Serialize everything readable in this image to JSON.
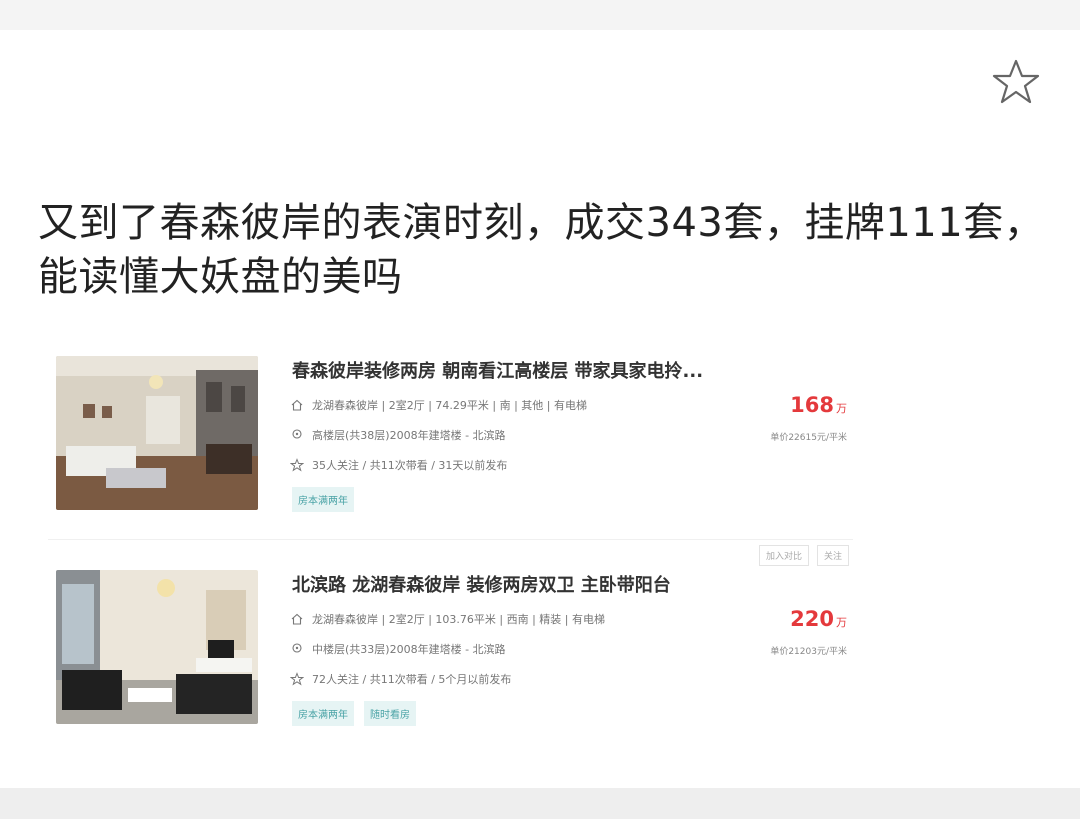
{
  "post": {
    "title": "又到了春森彼岸的表演时刻，成交343套，挂牌111套，能读懂大妖盘的美吗",
    "favorite_icon": "star-outline-icon"
  },
  "listings": [
    {
      "title": "春森彼岸装修两房 朝南看江高楼层 带家具家电拎...",
      "info": "龙湖春森彼岸 | 2室2厅 | 74.29平米 | 南 | 其他 | 有电梯",
      "floor": "高楼层(共38层)2008年建塔楼 - 北滨路",
      "follow": "35人关注 / 共11次带看 / 31天以前发布",
      "tags": [
        "房本满两年"
      ],
      "price": "168",
      "price_unit": "万",
      "unit_price": "单价22615元/平米"
    },
    {
      "title": "北滨路 龙湖春森彼岸 装修两房双卫 主卧带阳台",
      "info": "龙湖春森彼岸 | 2室2厅 | 103.76平米 | 西南 | 精装 | 有电梯",
      "floor": "中楼层(共33层)2008年建塔楼 - 北滨路",
      "follow": "72人关注 / 共11次带看 / 5个月以前发布",
      "tags": [
        "房本满两年",
        "随时看房"
      ],
      "price": "220",
      "price_unit": "万",
      "unit_price": "单价21203元/平米",
      "compare_label": "加入对比",
      "follow_label": "关注"
    }
  ]
}
